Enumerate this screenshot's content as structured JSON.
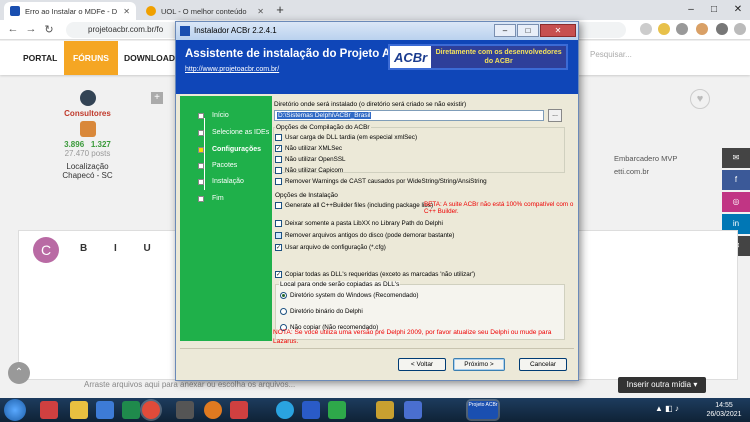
{
  "browser": {
    "tabs": [
      {
        "label": "Erro ao Instalar o MDFe - Dúvida",
        "active": true
      },
      {
        "label": "UOL - O melhor conteúdo",
        "active": false
      }
    ],
    "new_tab": "+",
    "url": "projetoacbr.com.br/fo",
    "window_controls": [
      "–",
      "□",
      "✕"
    ]
  },
  "forum": {
    "nav": [
      "PORTAL",
      "FÓRUNS",
      "DOWNLOADS"
    ],
    "active_nav": "FÓRUNS",
    "search_placeholder": "Pesquisar...",
    "user": {
      "rank": "Consultores",
      "reputation": "3.896",
      "solutions": "1.327",
      "posts": "27.470 posts",
      "location_label": "Localização",
      "location": "Chapecó - SC"
    },
    "side_link": "Embarcadero MVP",
    "side_link2": "etti.com.br",
    "editor_avatar_letter": "C",
    "editor_tools": "B I U S",
    "attach_text": "Arraste arquivos aqui para anexar ou escolha os arquivos...",
    "insert_media": "Inserir outra mídia ▾",
    "social": [
      "✉",
      "f",
      "◎",
      "in",
      "✉"
    ]
  },
  "installer": {
    "window_title": "Instalador ACBr 2.2.4.1",
    "header_title": "Assistente de instalação do Projeto ACBr",
    "header_link": "http://www.projetoacbr.com.br/",
    "logo_text": "ACBr",
    "logo_slogan": "Diretamente com os desenvolvedores do ACBr",
    "steps": [
      {
        "label": "Início",
        "current": false
      },
      {
        "label": "Selecione as IDEs",
        "current": false
      },
      {
        "label": "Configurações",
        "current": true
      },
      {
        "label": "Pacotes",
        "current": false
      },
      {
        "label": "Instalação",
        "current": false
      },
      {
        "label": "Fim",
        "current": false
      }
    ],
    "dir_label": "Diretório onde será instalado (o diretório será criado se não existir)",
    "dir_value": "D:\\Sistemas Delphi\\ACBr_Brasil",
    "browse_label": "...",
    "compile_group_title": "Opções de Compilação do ACBr",
    "compile_options": [
      {
        "label": "Usar carga de DLL tardia (em especial xmlSec)",
        "checked": false
      },
      {
        "label": "Não utilizar XMLSec",
        "checked": true
      },
      {
        "label": "Não utilizar OpenSSL",
        "checked": false
      },
      {
        "label": "Não utilizar Capicom",
        "checked": false
      },
      {
        "label": "Remover Warnings de CAST causados por WideString/String/AnsiString",
        "checked": false
      }
    ],
    "install_group_title": "Opções de Instalação",
    "install_options": [
      {
        "label": "Generate all C++Builder files (including package libs)",
        "checked": false
      },
      {
        "label": "Deixar somente a pasta LibXX no Library Path do Delphi",
        "checked": false
      },
      {
        "label": "Remover arquivos antigos do disco (pode demorar bastante)",
        "checked": false
      },
      {
        "label": "Usar arquivo de configuração (*.cfg)",
        "checked": true
      }
    ],
    "cbuilder_warning": "BETA: A suite ACBr não está 100% compatível com o C++ Builder.",
    "copy_dlls_label": "Copiar todas as DLL's requeridas (exceto as marcadas 'não utilizar')",
    "copy_dlls_checked": true,
    "dll_group_title": "Local para onde serão copiadas as DLL's",
    "dll_options": [
      {
        "label": "Diretório system do Windows (Recomendado)",
        "selected": true
      },
      {
        "label": "Diretório binário do Delphi",
        "selected": false
      },
      {
        "label": "Não copiar (Não recomendado)",
        "selected": false
      }
    ],
    "note": "NOTA: Se você utiliza uma versão pré Delphi 2009, por favor atualize seu Delphi ou mude para Lazarus.",
    "btn_back": "< Voltar",
    "btn_next": "Próximo >",
    "btn_cancel": "Cancelar"
  },
  "taskbar": {
    "time": "14:55",
    "date": "26/03/2021",
    "app_label": "Projeto ACBr"
  },
  "colors": {
    "installer_header": "#0f46b8",
    "installer_sidebar": "#1fb04a",
    "forum_accent": "#f5a623",
    "warning_red": "#e00000"
  }
}
